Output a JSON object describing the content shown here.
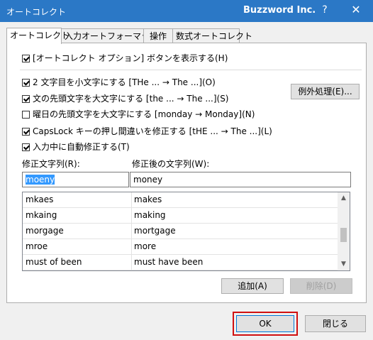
{
  "window": {
    "title": "オートコレクト",
    "company": "Buzzword Inc.",
    "help": "?",
    "close": "✕"
  },
  "tabs": [
    {
      "label": "オートコレクト",
      "active": true
    },
    {
      "label": "入力オートフォーマット",
      "active": false
    },
    {
      "label": "操作",
      "active": false
    },
    {
      "label": "数式オートコレクト",
      "active": false
    }
  ],
  "options": {
    "show_buttons": {
      "label": "[オートコレクト オプション] ボタンを表示する(H)",
      "checked": true
    },
    "two_caps": {
      "label": "2 文字目を小文字にする [THe ... → The ...](O)",
      "checked": true
    },
    "first_letter": {
      "label": "文の先頭文字を大文字にする [the ... → The ...](S)",
      "checked": true
    },
    "day_names": {
      "label": "曜日の先頭文字を大文字にする [monday → Monday](N)",
      "checked": false
    },
    "capslock": {
      "label": "CapsLock キーの押し間違いを修正する [tHE ... → The ...](L)",
      "checked": true
    },
    "replace_typing": {
      "label": "入力中に自動修正する(T)",
      "checked": true
    }
  },
  "exceptions_button": "例外処理(E)...",
  "replace": {
    "label": "修正文字列(R):",
    "value": "moeny"
  },
  "with": {
    "label": "修正後の文字列(W):",
    "value": "money"
  },
  "list": [
    {
      "from": "mkaes",
      "to": "makes"
    },
    {
      "from": "mkaing",
      "to": "making"
    },
    {
      "from": "morgage",
      "to": "mortgage"
    },
    {
      "from": "mroe",
      "to": "more"
    },
    {
      "from": "must of been",
      "to": "must have been"
    }
  ],
  "buttons": {
    "add": "追加(A)",
    "delete": "削除(D)",
    "ok": "OK",
    "close": "閉じる"
  }
}
